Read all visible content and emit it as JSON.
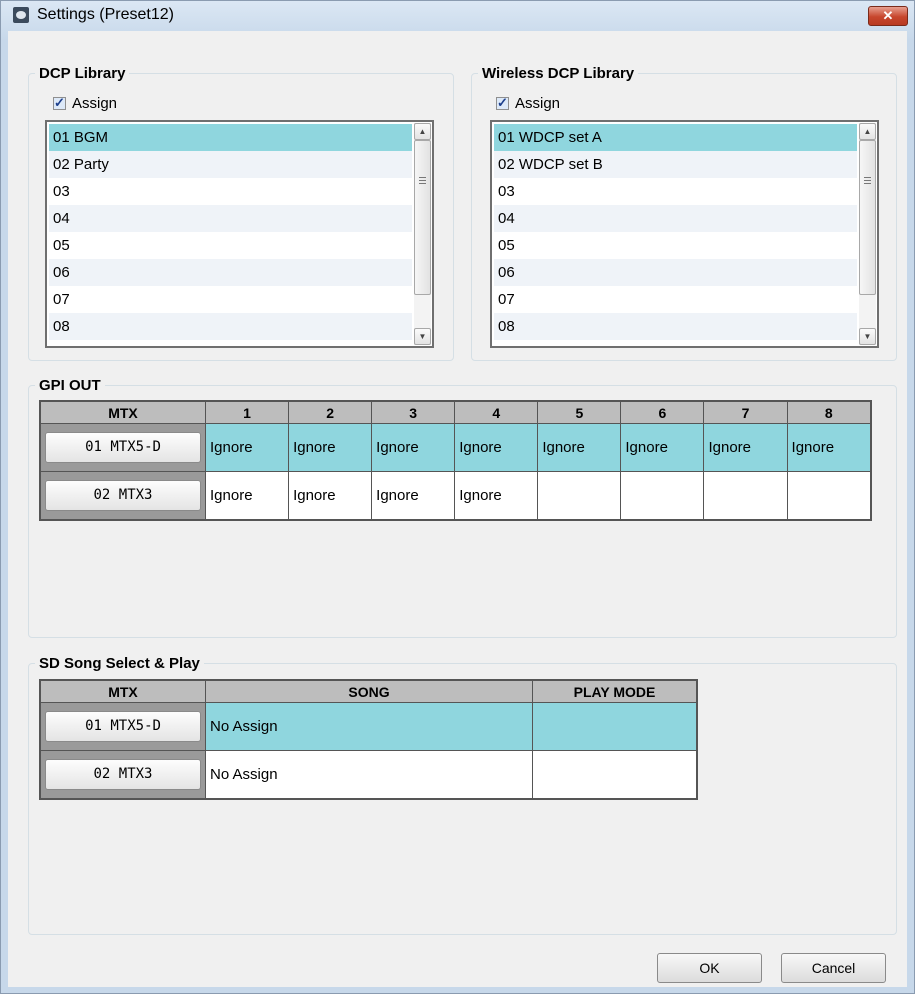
{
  "window": {
    "title": "Settings (Preset12)",
    "close_label": "✕"
  },
  "dcp_library": {
    "title": "DCP Library",
    "assign_label": "Assign",
    "assign_checked": true,
    "items": [
      "01 BGM",
      "02 Party",
      "03",
      "04",
      "05",
      "06",
      "07",
      "08"
    ],
    "selected": "01 BGM"
  },
  "wireless_dcp_library": {
    "title": "Wireless DCP Library",
    "assign_label": "Assign",
    "assign_checked": true,
    "items": [
      "01 WDCP set A",
      "02 WDCP set B",
      "03",
      "04",
      "05",
      "06",
      "07",
      "08"
    ],
    "selected": "01 WDCP set A"
  },
  "gpi_out": {
    "title": "GPI OUT",
    "headers": [
      "MTX",
      "1",
      "2",
      "3",
      "4",
      "5",
      "6",
      "7",
      "8"
    ],
    "rows": [
      {
        "mtx": "01 MTX5-D",
        "cells": [
          "Ignore",
          "Ignore",
          "Ignore",
          "Ignore",
          "Ignore",
          "Ignore",
          "Ignore",
          "Ignore"
        ]
      },
      {
        "mtx": "02 MTX3",
        "cells": [
          "Ignore",
          "Ignore",
          "Ignore",
          "Ignore",
          "",
          "",
          "",
          ""
        ]
      }
    ]
  },
  "sd_song": {
    "title": "SD Song Select & Play",
    "headers": [
      "MTX",
      "SONG",
      "PLAY MODE"
    ],
    "rows": [
      {
        "mtx": "01 MTX5-D",
        "song": "No Assign",
        "play_mode": ""
      },
      {
        "mtx": "02 MTX3",
        "song": "No Assign",
        "play_mode": ""
      }
    ]
  },
  "buttons": {
    "ok": "OK",
    "cancel": "Cancel"
  },
  "colors": {
    "selection": "#8fd6de",
    "header_bg": "#bdbdbd"
  }
}
